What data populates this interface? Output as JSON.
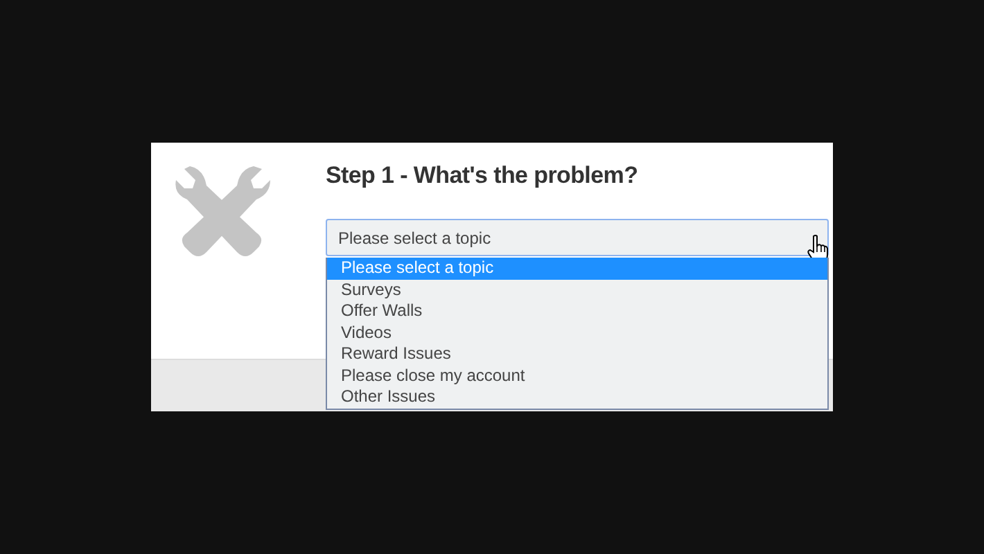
{
  "title": "Step 1 - What's the problem?",
  "select": {
    "value": "Please select a topic",
    "expanded": true
  },
  "options": [
    {
      "label": "Please select a topic",
      "selected": true
    },
    {
      "label": "Surveys",
      "selected": false
    },
    {
      "label": "Offer Walls",
      "selected": false
    },
    {
      "label": "Videos",
      "selected": false
    },
    {
      "label": "Reward Issues",
      "selected": false
    },
    {
      "label": "Please close my account",
      "selected": false
    },
    {
      "label": "Other Issues",
      "selected": false
    }
  ]
}
